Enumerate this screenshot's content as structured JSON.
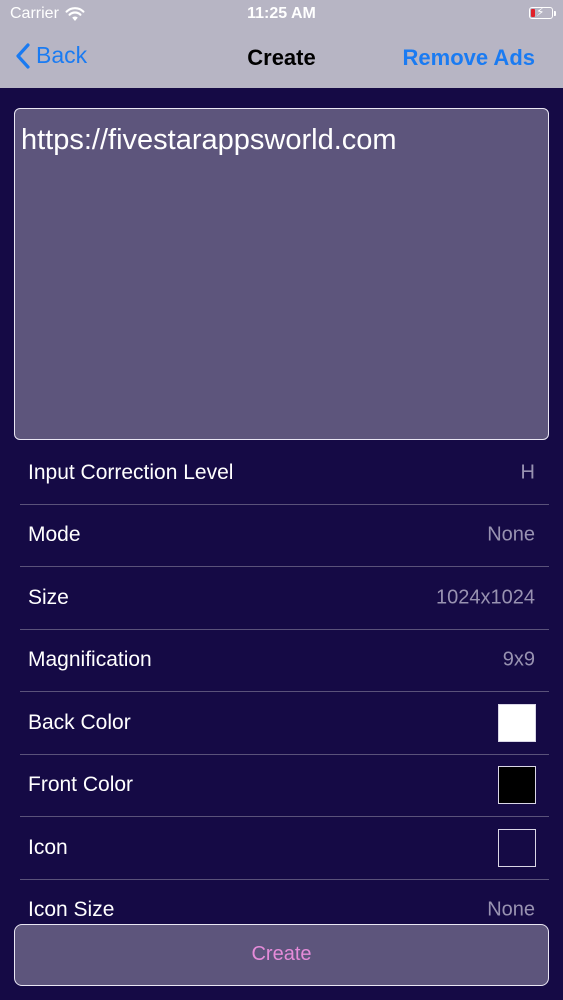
{
  "status_bar": {
    "carrier": "Carrier",
    "time": "11:25 AM",
    "battery_color": "#e0202a"
  },
  "nav": {
    "back_label": "Back",
    "title": "Create",
    "right_label": "Remove Ads",
    "accent": "#1a7bf2"
  },
  "input": {
    "value": "https://fivestarappsworld.com"
  },
  "settings": [
    {
      "label": "Input Correction Level",
      "value": "H"
    },
    {
      "label": "Mode",
      "value": "None"
    },
    {
      "label": "Size",
      "value": "1024x1024"
    },
    {
      "label": "Magnification",
      "value": "9x9"
    },
    {
      "label": "Back Color",
      "swatch": "#ffffff"
    },
    {
      "label": "Front Color",
      "swatch": "#000000"
    },
    {
      "label": "Icon",
      "swatch": "transparent"
    },
    {
      "label": "Icon Size",
      "value": "None"
    }
  ],
  "create_button": {
    "label": "Create"
  }
}
